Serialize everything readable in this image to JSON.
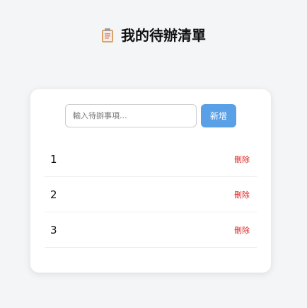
{
  "header": {
    "icon": "clipboard-icon",
    "title": "我的待辦清單"
  },
  "form": {
    "input_value": "",
    "placeholder": "輸入待辦事項...",
    "add_label": "新增"
  },
  "todos": [
    {
      "text": "1",
      "delete_label": "刪除"
    },
    {
      "text": "2",
      "delete_label": "刪除"
    },
    {
      "text": "3",
      "delete_label": "刪除"
    }
  ],
  "colors": {
    "accent": "#5aa0e6",
    "delete": "#e02424",
    "background": "#f4f5f7",
    "card": "#ffffff"
  }
}
